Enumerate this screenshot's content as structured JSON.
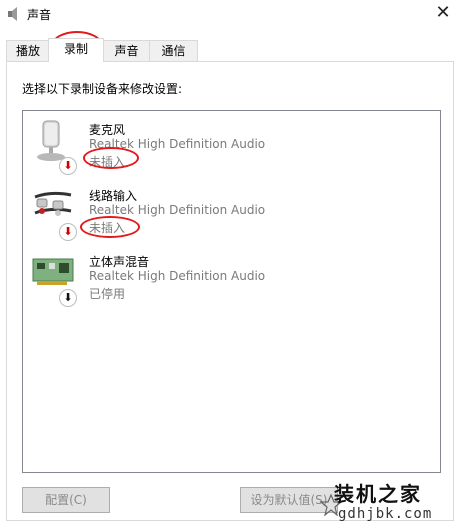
{
  "window": {
    "title": "声音",
    "close_glyph": "✕"
  },
  "tabs": [
    {
      "label": "播放"
    },
    {
      "label": "录制"
    },
    {
      "label": "声音"
    },
    {
      "label": "通信"
    }
  ],
  "prompt": "选择以下录制设备来修改设置:",
  "devices": [
    {
      "name": "麦克风",
      "description": "Realtek High Definition Audio",
      "status": "未插入",
      "icon": "microphone-icon",
      "badge": "down-arrow-red"
    },
    {
      "name": "线路输入",
      "description": "Realtek High Definition Audio",
      "status": "未插入",
      "icon": "line-in-cable-icon",
      "badge": "down-arrow-red"
    },
    {
      "name": "立体声混音",
      "description": "Realtek High Definition Audio",
      "status": "已停用",
      "icon": "sound-card-icon",
      "badge": "down-arrow-black"
    }
  ],
  "buttons": {
    "configure": "配置(C)",
    "set_default": "设为默认值(S)"
  },
  "watermark": {
    "line1": "装机之家",
    "line2": "gdhjbk.com"
  },
  "colors": {
    "annotation_red": "#e3191b",
    "disabled_text": "#7a7a7a",
    "badge_red": "#d00000"
  }
}
